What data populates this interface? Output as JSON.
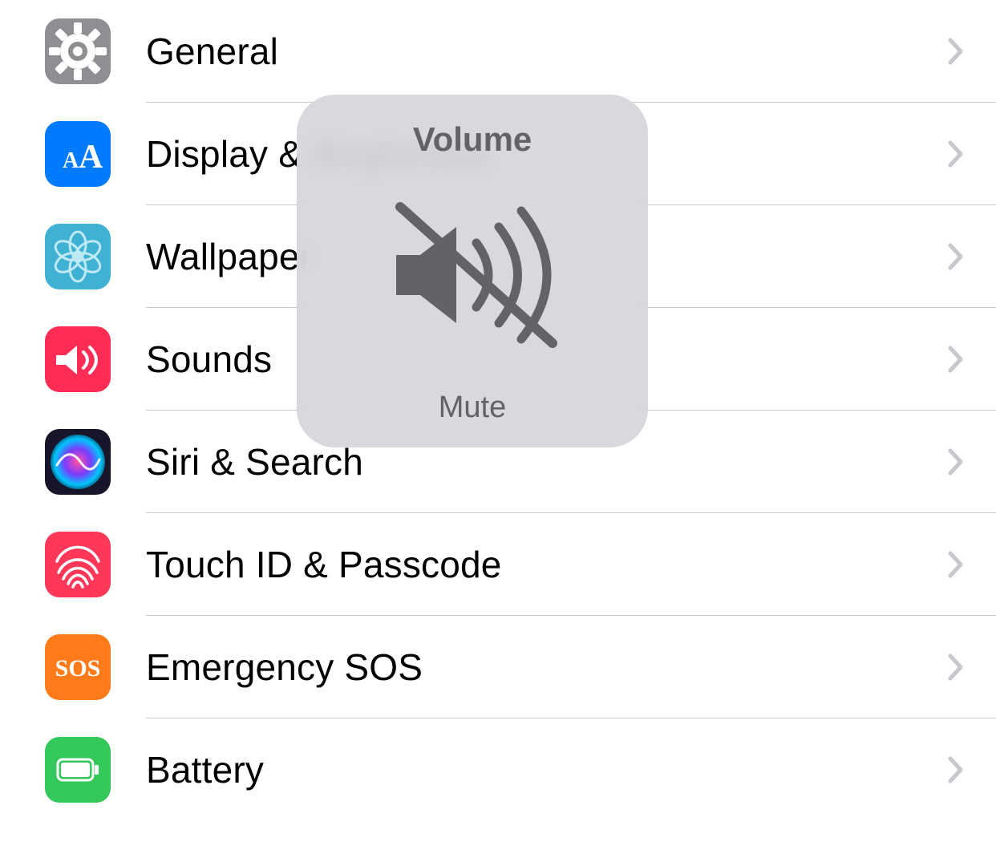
{
  "rows": [
    {
      "key": "general",
      "label": "General",
      "icon": "gear",
      "bg": "#8e8e93",
      "fg": "#ffffff"
    },
    {
      "key": "display",
      "label": "Display & Brightness",
      "icon": "aa",
      "bg": "#007aff",
      "fg": "#ffffff"
    },
    {
      "key": "wallpaper",
      "label": "Wallpaper",
      "icon": "flower",
      "bg": "#3fb2d4",
      "fg": "#bfe9f5"
    },
    {
      "key": "sounds",
      "label": "Sounds",
      "icon": "speaker",
      "bg": "#ff2d55",
      "fg": "#ffffff"
    },
    {
      "key": "siri",
      "label": "Siri & Search",
      "icon": "siri",
      "bg": "#17152a",
      "fg": "#ffffff"
    },
    {
      "key": "touchid",
      "label": "Touch ID & Passcode",
      "icon": "fingerprint",
      "bg": "#ff3758",
      "fg": "#ffffff"
    },
    {
      "key": "sos",
      "label": "Emergency SOS",
      "icon": "sos",
      "bg": "#ff7b1a",
      "fg": "#ffffff"
    },
    {
      "key": "battery",
      "label": "Battery",
      "icon": "battery",
      "bg": "#34c759",
      "fg": "#ffffff"
    }
  ],
  "hud": {
    "title": "Volume",
    "status": "Mute"
  }
}
